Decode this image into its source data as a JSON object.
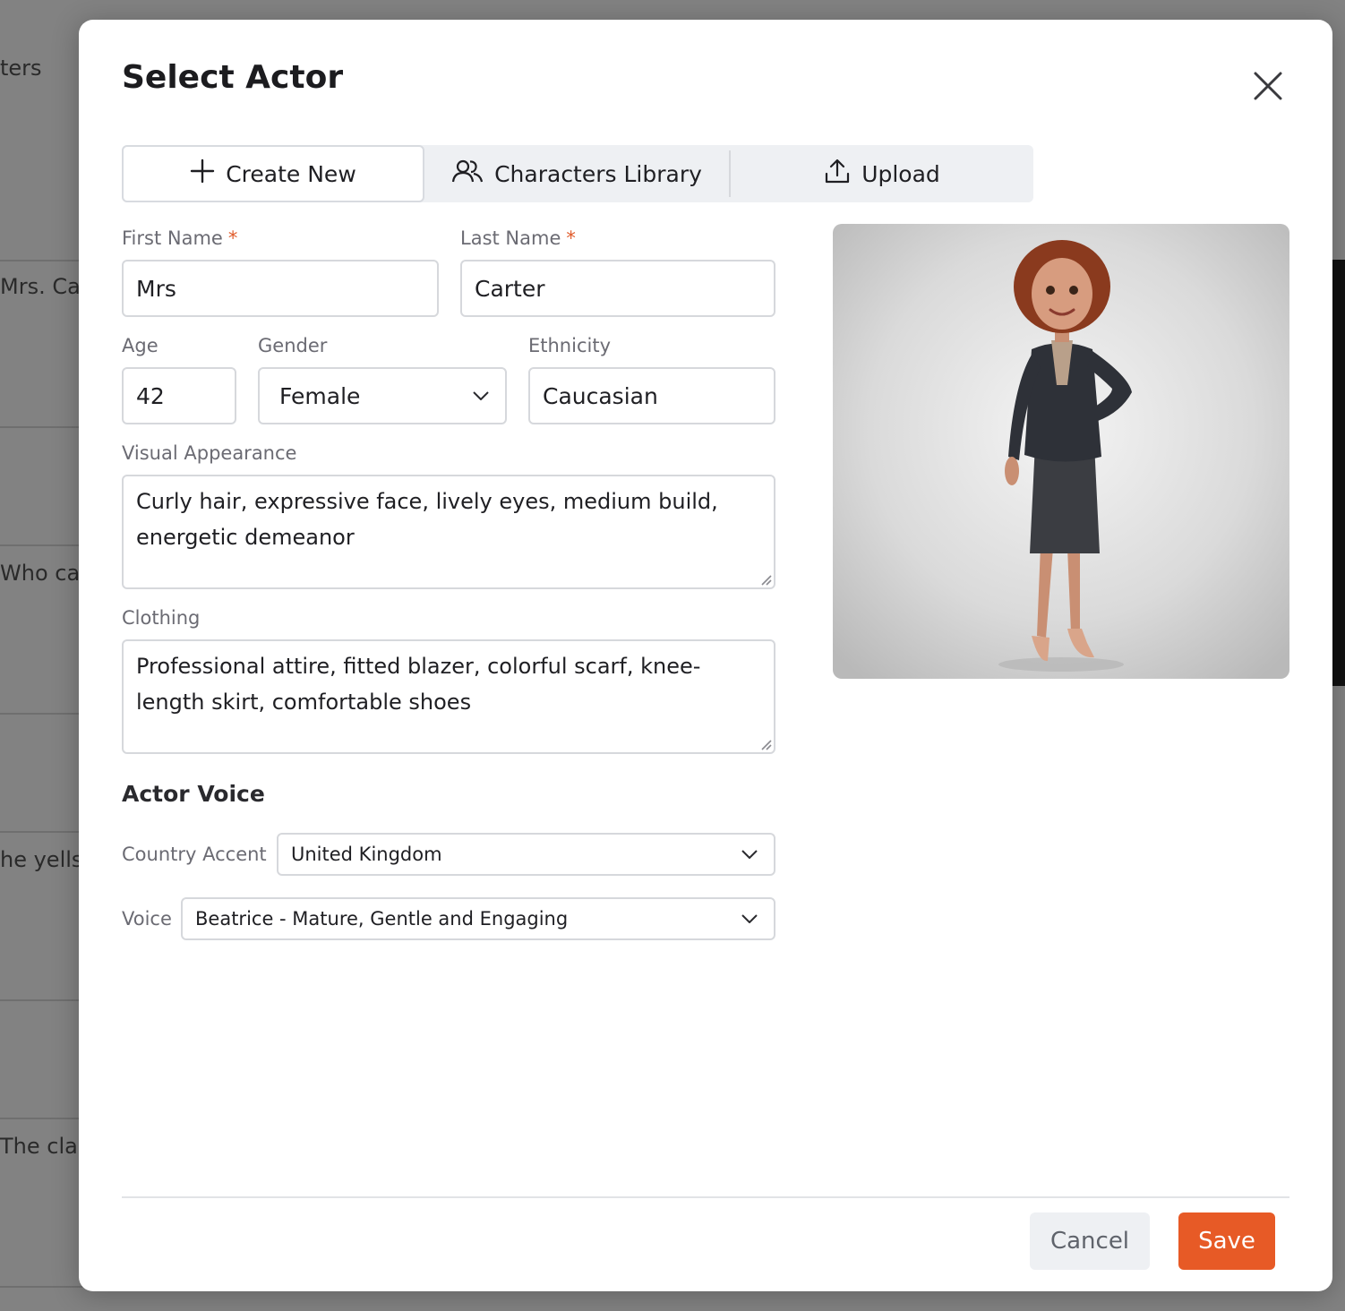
{
  "background": {
    "rows": [
      "ters",
      "Mrs. Car",
      "Who car",
      "he yells",
      "The clas"
    ]
  },
  "modal": {
    "title": "Select Actor",
    "close_icon": "close-icon",
    "tabs": [
      {
        "label": "Create New",
        "icon": "plus-icon",
        "active": true
      },
      {
        "label": "Characters Library",
        "icon": "users-icon",
        "active": false
      },
      {
        "label": "Upload",
        "icon": "upload-icon",
        "active": false
      }
    ],
    "form": {
      "first_name": {
        "label": "First Name",
        "required_mark": "*",
        "value": "Mrs"
      },
      "last_name": {
        "label": "Last Name",
        "required_mark": "*",
        "value": "Carter"
      },
      "age": {
        "label": "Age",
        "value": "42"
      },
      "gender": {
        "label": "Gender",
        "value": "Female"
      },
      "ethnicity": {
        "label": "Ethnicity",
        "value": "Caucasian"
      },
      "visual_appearance": {
        "label": "Visual Appearance",
        "line1": "Curly hair, expressive face, lively eyes, medium build,",
        "line2": "energetic demeanor"
      },
      "clothing": {
        "label": "Clothing",
        "line1": "Professional attire, fitted blazer, colorful scarf, knee-",
        "line2": "length skirt, comfortable shoes"
      }
    },
    "voice": {
      "section_title": "Actor Voice",
      "country_accent": {
        "label": "Country Accent",
        "value": "United Kingdom"
      },
      "voice": {
        "label": "Voice",
        "value": "Beatrice - Mature, Gentle and Engaging"
      }
    },
    "footer": {
      "cancel_label": "Cancel",
      "save_label": "Save"
    }
  },
  "colors": {
    "accent": "#e75a26",
    "required": "#e05b2b"
  }
}
